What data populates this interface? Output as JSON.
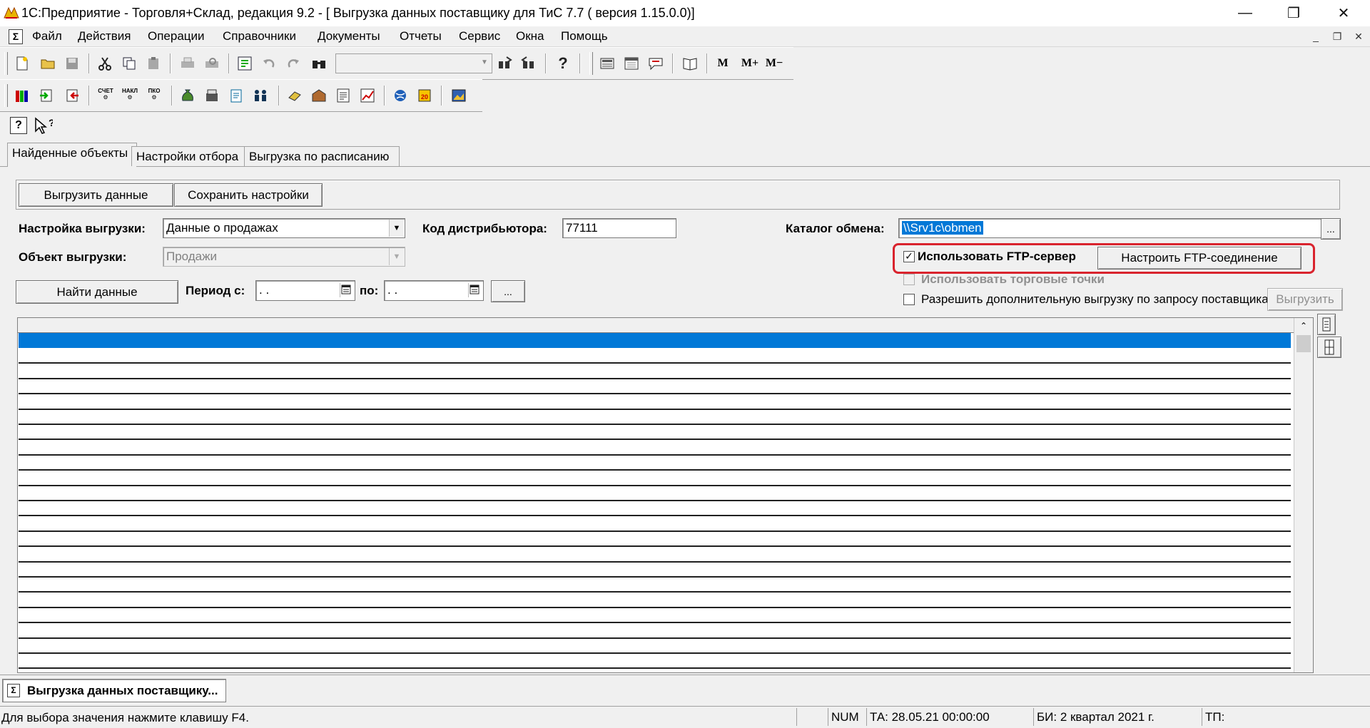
{
  "window": {
    "title": "1С:Предприятие - Торговля+Склад, редакция 9.2 - [ Выгрузка данных поставщику для ТиС 7.7 ( версия 1.15.0.0)]",
    "minimize": "—",
    "restore": "❐",
    "close": "✕"
  },
  "menu": {
    "items": [
      "Файл",
      "Действия",
      "Операции",
      "Справочники",
      "Документы",
      "Отчеты",
      "Сервис",
      "Окна",
      "Помощь"
    ],
    "mdi_minimize": "_",
    "mdi_restore": "❐",
    "mdi_close": "✕"
  },
  "toolbar": {
    "mem_m": "M",
    "mem_mplus": "M+",
    "mem_mminus": "M−",
    "help_q": "?",
    "icon2_labels": [
      "СЧЕТ",
      "НАКЛ",
      "ПКО"
    ]
  },
  "tabs": [
    "Найденные объекты",
    "Настройки отбора",
    "Выгрузка по расписанию"
  ],
  "form": {
    "export_button": "Выгрузить данные",
    "save_settings_button": "Сохранить настройки",
    "export_setting_label": "Настройка выгрузки:",
    "export_setting_value": "Данные о продажах",
    "distributor_code_label": "Код дистрибьютора:",
    "distributor_code_value": "77111",
    "exchange_dir_label": "Каталог обмена:",
    "exchange_dir_value": "\\\\Srv1c\\obmen",
    "browse_button": "...",
    "export_object_label": "Объект выгрузки:",
    "export_object_value": "Продажи",
    "use_ftp_label": "Использовать FTP-сервер",
    "use_ftp_checked": true,
    "ftp_settings_button": "Настроить FTP-соединение",
    "use_trade_points_label": "Использовать торговые точки",
    "allow_extra_export_label": "Разрешить дополнительную выгрузку по запросу поставщика",
    "extra_export_button": "Выгрузить",
    "find_data_button": "Найти данные",
    "period_from_label": "Период с:",
    "period_from_value": " .  .",
    "period_to_label": "по:",
    "period_to_value": " .  .",
    "period_button": "..."
  },
  "grid": {
    "selected_row_color": "#0078d7",
    "row_count": 27
  },
  "taskbar": {
    "item_label": "Выгрузка данных поставщику..."
  },
  "status": {
    "hint": "Для выбора значения нажмите клавишу F4.",
    "num": "NUM",
    "ta": "ТА: 28.05.21  00:00:00",
    "bi": "БИ: 2 квартал 2021 г.",
    "tp": "ТП:"
  },
  "colors": {
    "highlight_frame": "#d9232d",
    "selection": "#0078d7"
  }
}
